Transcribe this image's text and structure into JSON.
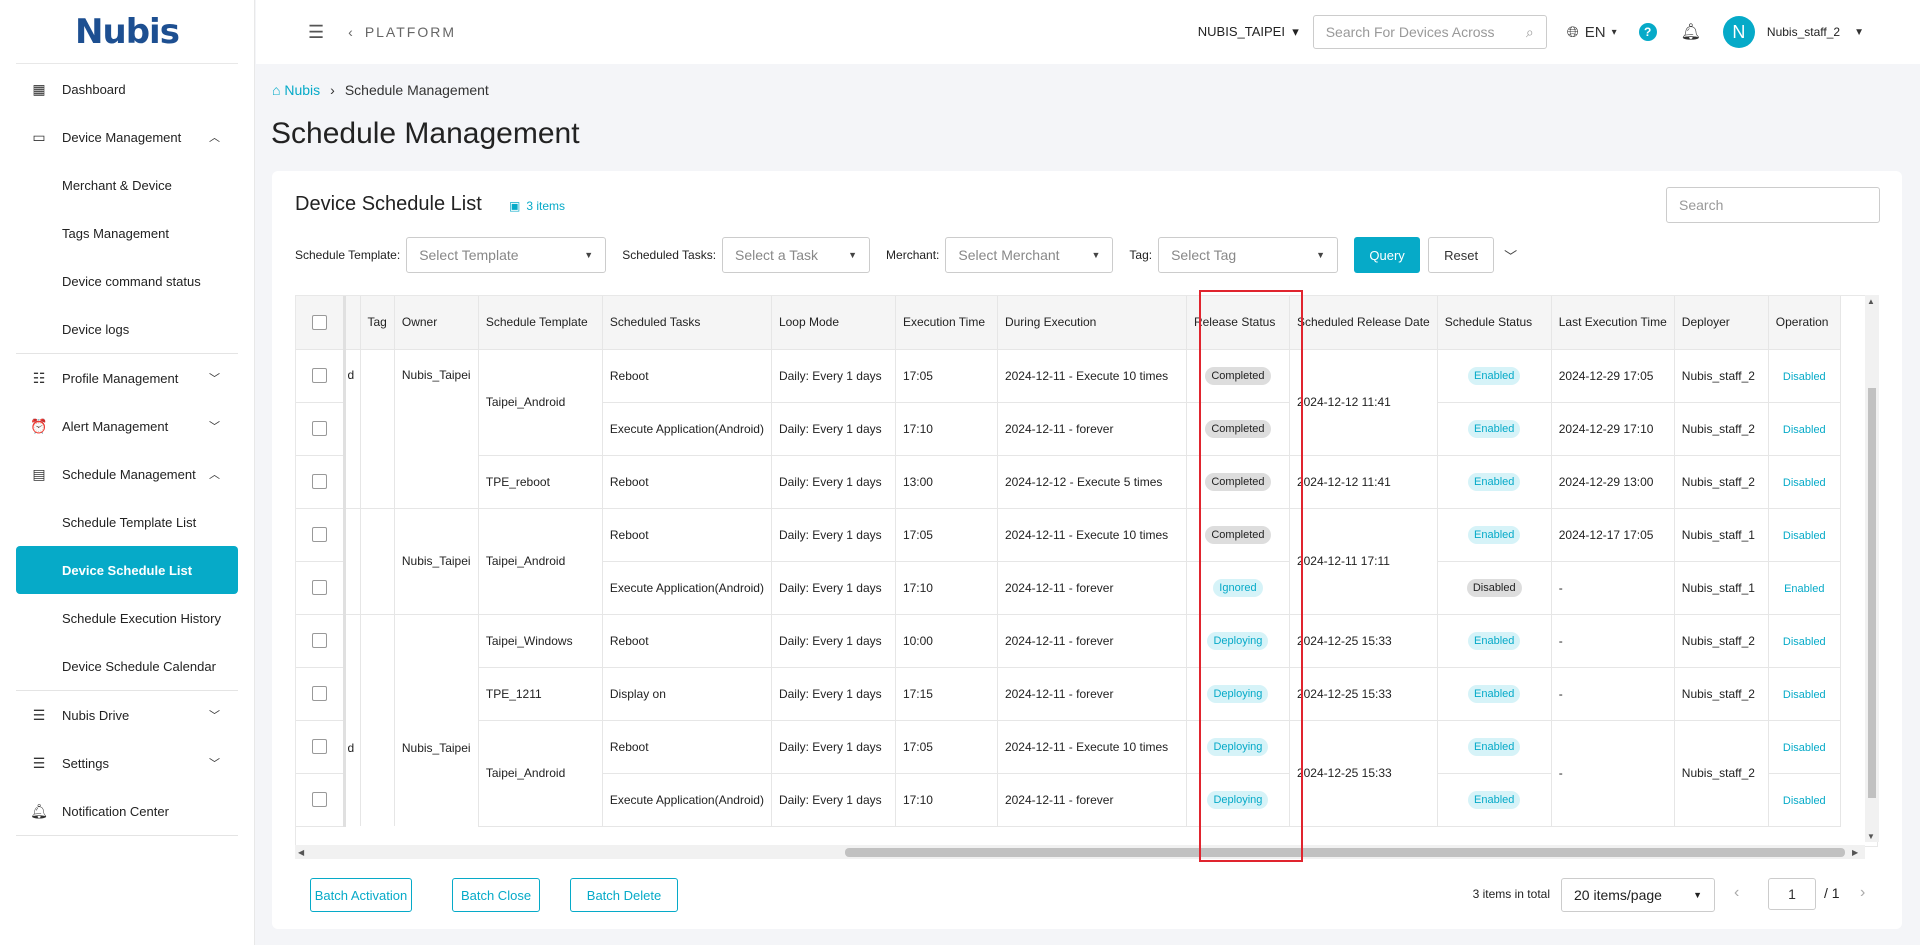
{
  "sidebar": {
    "logo": "Nubis",
    "items": [
      {
        "label": "Dashboard"
      },
      {
        "label": "Device Management"
      },
      {
        "label": "Merchant & Device"
      },
      {
        "label": "Tags Management"
      },
      {
        "label": "Device command status"
      },
      {
        "label": "Device logs"
      },
      {
        "label": "Profile Management"
      },
      {
        "label": "Alert Management"
      },
      {
        "label": "Schedule Management"
      },
      {
        "label": "Schedule Template List"
      },
      {
        "label": "Device Schedule List"
      },
      {
        "label": "Schedule Execution History"
      },
      {
        "label": "Device Schedule Calendar"
      },
      {
        "label": "Nubis Drive"
      },
      {
        "label": "Settings"
      },
      {
        "label": "Notification Center"
      }
    ]
  },
  "header": {
    "platform": "PLATFORM",
    "org": "NUBIS_TAIPEI",
    "search_placeholder": "Search For Devices Across",
    "lang": "EN",
    "avatar_initial": "N",
    "user": "Nubis_staff_2"
  },
  "breadcrumb": {
    "home": "Nubis",
    "current": "Schedule Management"
  },
  "page_title": "Schedule Management",
  "card": {
    "title": "Device Schedule List",
    "count": "3 items",
    "search_placeholder": "Search"
  },
  "filters": {
    "template_label": "Schedule Template:",
    "template_placeholder": "Select Template",
    "tasks_label": "Scheduled Tasks:",
    "tasks_placeholder": "Select a Task",
    "merchant_label": "Merchant:",
    "merchant_placeholder": "Select Merchant",
    "tag_label": "Tag:",
    "tag_placeholder": "Select Tag",
    "query": "Query",
    "reset": "Reset"
  },
  "table": {
    "headers": [
      "Tag",
      "Owner",
      "Schedule Template",
      "Scheduled Tasks",
      "Loop Mode",
      "Execution Time",
      "During Execution",
      "Release Status",
      "Scheduled Release Date",
      "Schedule Status",
      "Last Execution Time",
      "Deployer",
      "Operation"
    ],
    "cut_text": "d",
    "owner": "Nubis_Taipei",
    "templates": [
      "Taipei_Android",
      "TPE_reboot",
      "Taipei_Android",
      "Taipei_Windows",
      "TPE_1211",
      "Taipei_Android"
    ],
    "release_dates": [
      "2024-12-12 11:41",
      "2024-12-12 11:41",
      "2024-12-11 17:11",
      "2024-12-25 15:33",
      "2024-12-25 15:33",
      "2024-12-25 15:33"
    ],
    "rows": [
      {
        "task": "Reboot",
        "loop": "Daily: Every 1 days",
        "time": "17:05",
        "during": "2024-12-11 - Execute 10 times",
        "release": "Completed",
        "status": "Enabled",
        "last": "2024-12-29 17:05",
        "deployer": "Nubis_staff_2",
        "op": "Disabled"
      },
      {
        "task": "Execute Application(Android)",
        "loop": "Daily: Every 1 days",
        "time": "17:10",
        "during": "2024-12-11 - forever",
        "release": "Completed",
        "status": "Enabled",
        "last": "2024-12-29 17:10",
        "deployer": "Nubis_staff_2",
        "op": "Disabled"
      },
      {
        "task": "Reboot",
        "loop": "Daily: Every 1 days",
        "time": "13:00",
        "during": "2024-12-12 - Execute 5 times",
        "release": "Completed",
        "status": "Enabled",
        "last": "2024-12-29 13:00",
        "deployer": "Nubis_staff_2",
        "op": "Disabled"
      },
      {
        "task": "Reboot",
        "loop": "Daily: Every 1 days",
        "time": "17:05",
        "during": "2024-12-11 - Execute 10 times",
        "release": "Completed",
        "status": "Enabled",
        "last": "2024-12-17 17:05",
        "deployer": "Nubis_staff_1",
        "op": "Disabled"
      },
      {
        "task": "Execute Application(Android)",
        "loop": "Daily: Every 1 days",
        "time": "17:10",
        "during": "2024-12-11 - forever",
        "release": "Ignored",
        "status": "Disabled",
        "last": "-",
        "deployer": "Nubis_staff_1",
        "op": "Enabled"
      },
      {
        "task": "Reboot",
        "loop": "Daily: Every 1 days",
        "time": "10:00",
        "during": "2024-12-11 - forever",
        "release": "Deploying",
        "status": "Enabled",
        "last": "-",
        "deployer": "Nubis_staff_2",
        "op": "Disabled"
      },
      {
        "task": "Display on",
        "loop": "Daily: Every 1 days",
        "time": "17:15",
        "during": "2024-12-11 - forever",
        "release": "Deploying",
        "status": "Enabled",
        "last": "-",
        "deployer": "Nubis_staff_2",
        "op": "Disabled"
      },
      {
        "task": "Reboot",
        "loop": "Daily: Every 1 days",
        "time": "17:05",
        "during": "2024-12-11 - Execute 10 times",
        "release": "Deploying",
        "status": "Enabled",
        "last": "-",
        "deployer": "Nubis_staff_2",
        "op": "Disabled"
      },
      {
        "task": "Execute Application(Android)",
        "loop": "Daily: Every 1 days",
        "time": "17:10",
        "during": "2024-12-11 - forever",
        "release": "Deploying",
        "status": "Enabled",
        "last": "",
        "deployer": "",
        "op": "Disabled"
      }
    ]
  },
  "footer": {
    "batch_activation": "Batch Activation",
    "batch_close": "Batch Close",
    "batch_delete": "Batch Delete",
    "total": "3 items in total",
    "per_page": "20 items/page",
    "page": "1",
    "page_total": "/ 1"
  }
}
